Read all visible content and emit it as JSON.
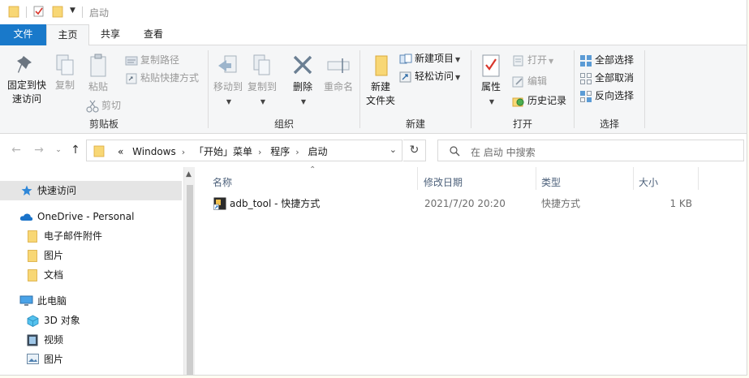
{
  "window": {
    "title": "启动"
  },
  "tabs": [
    {
      "label": "文件"
    },
    {
      "label": "主页"
    },
    {
      "label": "共享"
    },
    {
      "label": "查看"
    }
  ],
  "ribbon": {
    "clipboard": {
      "label": "剪贴板",
      "pin_line1": "固定到快",
      "pin_line2": "速访问",
      "copy": "复制",
      "paste": "粘贴",
      "copy_path": "复制路径",
      "paste_shortcut": "粘贴快捷方式",
      "cut": "剪切"
    },
    "organize": {
      "label": "组织",
      "move_to": "移动到",
      "copy_to": "复制到",
      "delete": "删除",
      "rename": "重命名"
    },
    "new": {
      "label": "新建",
      "new_folder_line1": "新建",
      "new_folder_line2": "文件夹",
      "new_item": "新建项目",
      "easy_access": "轻松访问"
    },
    "open": {
      "label": "打开",
      "properties": "属性",
      "open": "打开",
      "edit": "编辑",
      "history": "历史记录"
    },
    "select": {
      "label": "选择",
      "select_all": "全部选择",
      "select_none": "全部取消",
      "invert": "反向选择"
    }
  },
  "address": {
    "overflow": "«",
    "crumbs": [
      "Windows",
      "「开始」菜单",
      "程序",
      "启动"
    ]
  },
  "search": {
    "placeholder": "在 启动 中搜索"
  },
  "nav": {
    "items": [
      {
        "label": "快速访问"
      },
      {
        "label": "OneDrive - Personal"
      },
      {
        "label": "电子邮件附件"
      },
      {
        "label": "图片"
      },
      {
        "label": "文档"
      },
      {
        "label": "此电脑"
      },
      {
        "label": "3D 对象"
      },
      {
        "label": "视频"
      },
      {
        "label": "图片"
      }
    ]
  },
  "columns": {
    "name": "名称",
    "modified": "修改日期",
    "type": "类型",
    "size": "大小"
  },
  "files": [
    {
      "name": "adb_tool - 快捷方式",
      "modified": "2021/7/20 20:20",
      "type": "快捷方式",
      "size": "1 KB"
    }
  ],
  "colors": {
    "accent": "#1979ca",
    "folder": "#f8d775",
    "ribbon_bg": "#f5f6f7",
    "selection": "#e5e5e5"
  }
}
